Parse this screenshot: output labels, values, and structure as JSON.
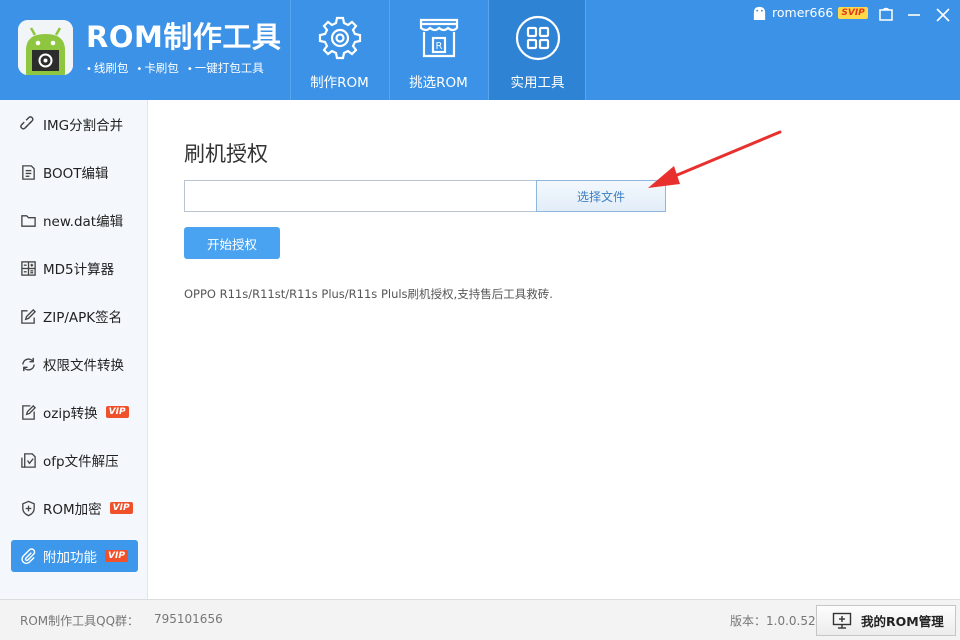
{
  "header": {
    "app_title": "ROM制作工具",
    "subtitle": [
      "线刷包",
      "卡刷包",
      "一键打包工具"
    ],
    "tabs": [
      {
        "label": "制作ROM",
        "icon": "gear-icon"
      },
      {
        "label": "挑选ROM",
        "icon": "store-icon"
      },
      {
        "label": "实用工具",
        "icon": "grid-icon"
      }
    ],
    "active_tab": "实用工具",
    "user": {
      "name": "romer666",
      "badge": "SVIP"
    }
  },
  "sidebar": {
    "items": [
      {
        "label": "IMG分割合并",
        "icon": "link-icon"
      },
      {
        "label": "BOOT编辑",
        "icon": "document-icon"
      },
      {
        "label": "new.dat编辑",
        "icon": "folder-icon"
      },
      {
        "label": "MD5计算器",
        "icon": "calculator-icon"
      },
      {
        "label": "ZIP/APK签名",
        "icon": "edit-icon"
      },
      {
        "label": "权限文件转换",
        "icon": "refresh-icon"
      },
      {
        "label": "ozip转换",
        "icon": "edit-file-icon",
        "badge": "VIP"
      },
      {
        "label": "ofp文件解压",
        "icon": "extract-icon"
      },
      {
        "label": "ROM加密",
        "icon": "shield-plus-icon",
        "badge": "VIP"
      },
      {
        "label": "附加功能",
        "icon": "paperclip-icon",
        "badge": "VIP"
      }
    ],
    "active_index": 9
  },
  "main": {
    "title": "刷机授权",
    "file_input_value": "",
    "choose_file_label": "选择文件",
    "start_label": "开始授权",
    "description": "OPPO R11s/R11st/R11s Plus/R11s Pluls刷机授权,支持售后工具救砖."
  },
  "footer": {
    "qq_label": "ROM制作工具QQ群：",
    "qq_number": "795101656",
    "version": "版本：1.0.0.52",
    "manage_label": "我的ROM管理"
  },
  "colors": {
    "header_bg": "#3b92e6",
    "active_tab_bg": "#2f83d4",
    "sidebar_active": "#3d97ea",
    "vip_badge": "#f0502a",
    "annotation_arrow": "#e8312f"
  }
}
